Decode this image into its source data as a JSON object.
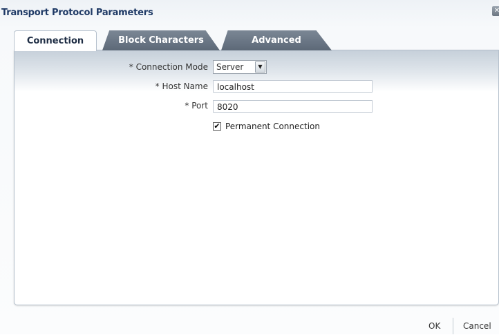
{
  "dialog": {
    "title": "Transport Protocol Parameters",
    "close_icon": "close-icon"
  },
  "tabs": [
    {
      "label": "Connection",
      "active": true
    },
    {
      "label": "Block Characters",
      "active": false
    },
    {
      "label": "Advanced",
      "active": false
    }
  ],
  "form": {
    "required_marker": "*",
    "connection_mode": {
      "label": "Connection Mode",
      "value": "Server"
    },
    "host_name": {
      "label": "Host Name",
      "value": "localhost"
    },
    "port": {
      "label": "Port",
      "value": "8020"
    },
    "permanent_connection": {
      "label": "Permanent Connection",
      "checked": true,
      "glyph": "✔"
    }
  },
  "footer": {
    "ok_label": "OK",
    "cancel_label": "Cancel"
  }
}
